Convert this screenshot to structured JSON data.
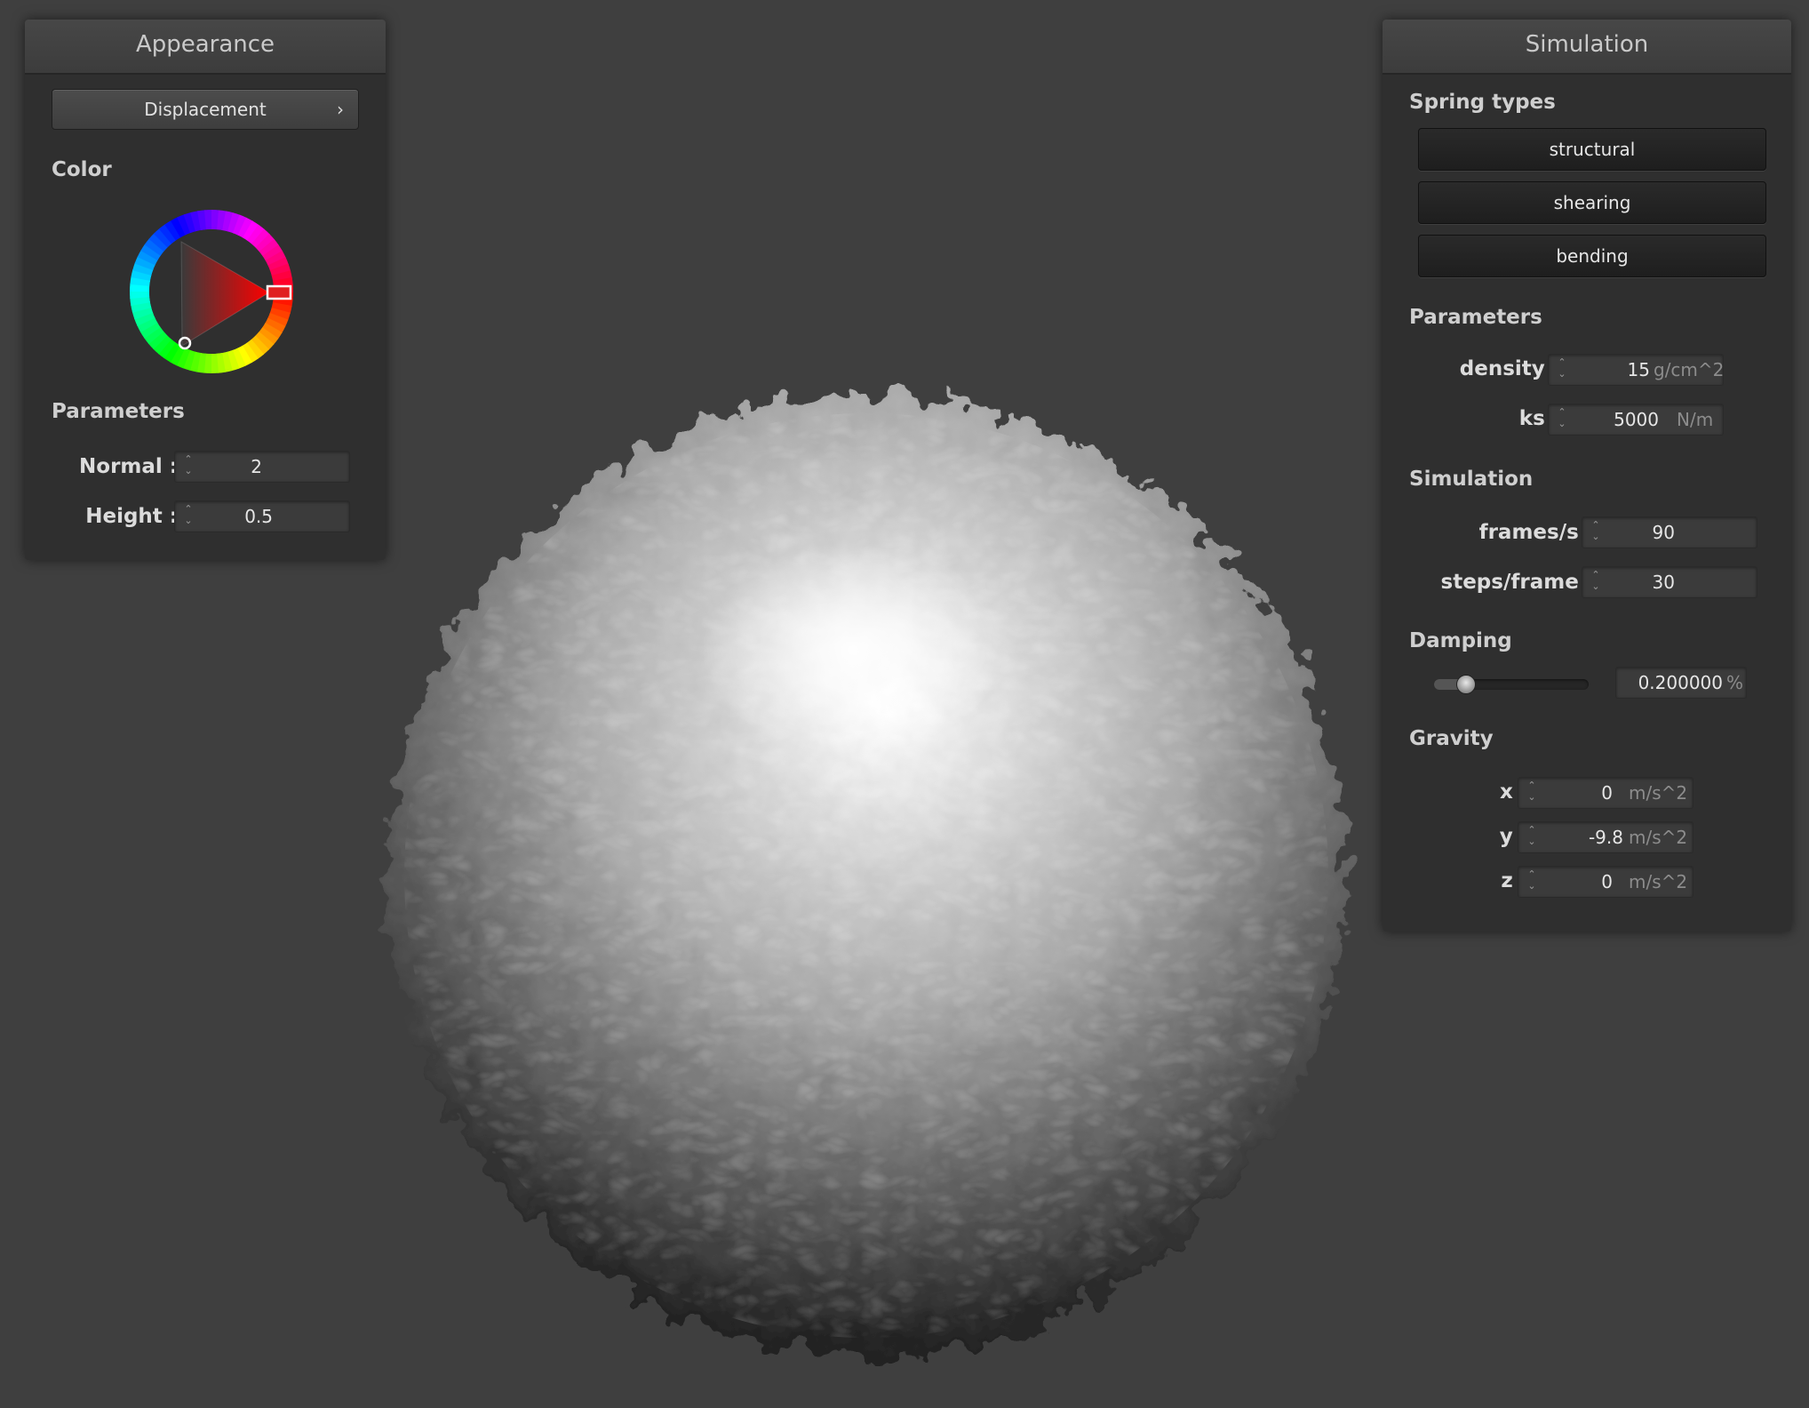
{
  "appearance": {
    "title": "Appearance",
    "displacement_button": "Displacement",
    "chevron": "›",
    "color_label": "Color",
    "color_value": "#ff0000",
    "parameters_label": "Parameters",
    "normal": {
      "label": "Normal :",
      "value": "2"
    },
    "height": {
      "label": "Height :",
      "value": "0.5"
    }
  },
  "simulation_panel": {
    "title": "Simulation",
    "spring_types_label": "Spring types",
    "spring_buttons": [
      "structural",
      "shearing",
      "bending"
    ],
    "parameters_label": "Parameters",
    "density": {
      "label": "density :",
      "value": "15",
      "unit": "g/cm^2"
    },
    "ks": {
      "label": "ks :",
      "value": "5000",
      "unit": "N/m"
    },
    "simulation_label": "Simulation",
    "frames": {
      "label": "frames/s :",
      "value": "90"
    },
    "steps": {
      "label": "steps/frame :",
      "value": "30"
    },
    "damping_label": "Damping",
    "damping": {
      "value": "0.200000",
      "unit": "%",
      "level": 0.2
    },
    "gravity_label": "Gravity",
    "gravity": [
      {
        "label": "x :",
        "value": "0",
        "unit": "m/s^2"
      },
      {
        "label": "y :",
        "value": "-9.8",
        "unit": "m/s^2"
      },
      {
        "label": "z :",
        "value": "0",
        "unit": "m/s^2"
      }
    ]
  },
  "icons": {
    "spin_up": "⌃",
    "spin_down": "⌄"
  },
  "colors": {
    "background": "#3f3f3f",
    "panel": "#2f2f2f",
    "accent_red": "#ff0000"
  }
}
